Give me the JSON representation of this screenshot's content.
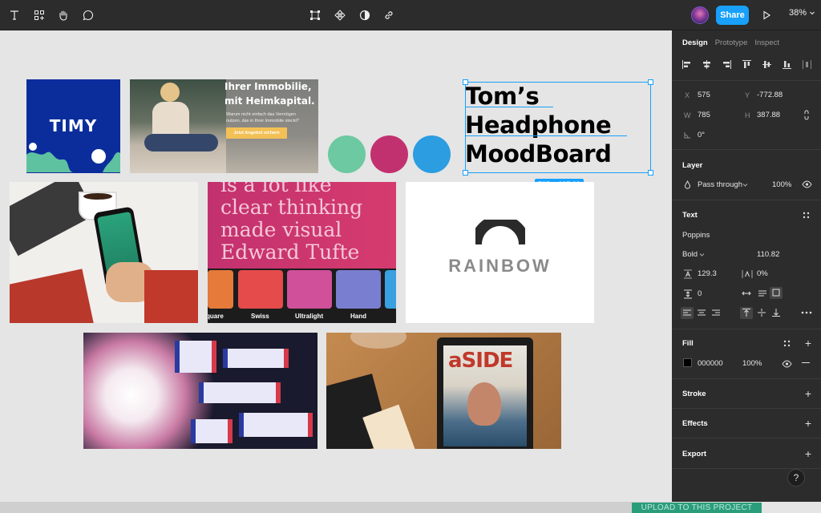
{
  "toolbar": {
    "tools": [
      "text-tool-icon",
      "components-icon",
      "hand-tool-icon",
      "comment-icon"
    ],
    "center_tools": [
      "frame-icon",
      "component-diamond-icon",
      "contrast-icon",
      "link-icon"
    ],
    "share_label": "Share",
    "zoom_label": "38%"
  },
  "canvas": {
    "title_line1": "Tom’s",
    "title_line2": "Headphone",
    "title_line3": "MoodBoard",
    "size_badge": "785 × 387.88",
    "timy_logo": "TIMY",
    "banner_line1": "Ihrer Immobilie,",
    "banner_line2": "mit Heimkapital.",
    "banner_body1": "Warum nicht einfach das Vermögen",
    "banner_body2": "nutzen, das in Ihrer Immobilie steckt?",
    "banner_cta": "Jetzt Angebot sichern",
    "quote_line0": "is a lot like",
    "quote_line1": "clear thinking",
    "quote_line2": "made visual",
    "quote_line3": "Edward Tufte",
    "swatch_labels": [
      "quare",
      "Swiss",
      "Ultralight",
      "Hand"
    ],
    "rainbow_logo": "RAINBOW",
    "magazine_logo": "aSIDE",
    "circle_colors": [
      "#6cc9a1",
      "#c2316f",
      "#2b9de0"
    ],
    "upload_label": "UPLOAD TO THIS PROJECT"
  },
  "panel": {
    "tabs": [
      "Design",
      "Prototype",
      "Inspect"
    ],
    "x_label": "X",
    "x_value": "575",
    "y_label": "Y",
    "y_value": "-772.88",
    "w_label": "W",
    "w_value": "785",
    "h_label": "H",
    "h_value": "387.88",
    "rotation_value": "0°",
    "layer_title": "Layer",
    "blend_mode": "Pass through",
    "layer_opacity": "100%",
    "text_title": "Text",
    "font_family": "Poppins",
    "font_weight": "Bold",
    "font_size": "110.82",
    "line_height": "129.3",
    "letter_spacing": "0%",
    "paragraph_spacing": "0",
    "fill_title": "Fill",
    "fill_hex": "000000",
    "fill_opacity": "100%",
    "fill_color": "#000000",
    "stroke_title": "Stroke",
    "effects_title": "Effects",
    "export_title": "Export",
    "help_label": "?"
  }
}
